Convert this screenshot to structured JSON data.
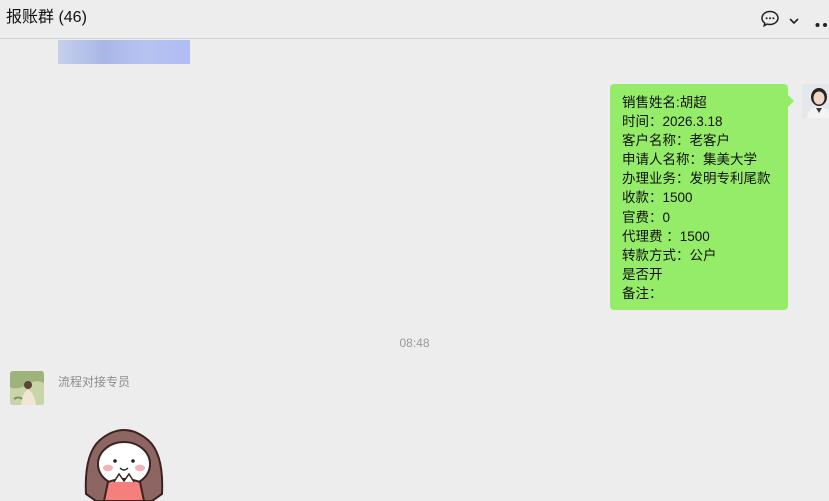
{
  "header": {
    "title": "报账群 (46)",
    "icons": [
      "chat-bubble-icon",
      "chevron-down-icon",
      "more-icon"
    ]
  },
  "messages": [
    {
      "side": "right",
      "lines": [
        "销售姓名:胡超",
        "时间：2026.3.18",
        "客户名称：老客户",
        "申请人名称：集美大学",
        "办理业务：发明专利尾款",
        "收款：1500",
        "官费：0",
        "代理费 ：1500",
        "转款方式：公户",
        "是否开",
        "备注："
      ]
    }
  ],
  "timestamp": "08:48",
  "incoming": {
    "sender": "流程对接专员",
    "content": "sticker"
  },
  "colors": {
    "bubble_green": "#95ec69",
    "background": "#ededed"
  }
}
